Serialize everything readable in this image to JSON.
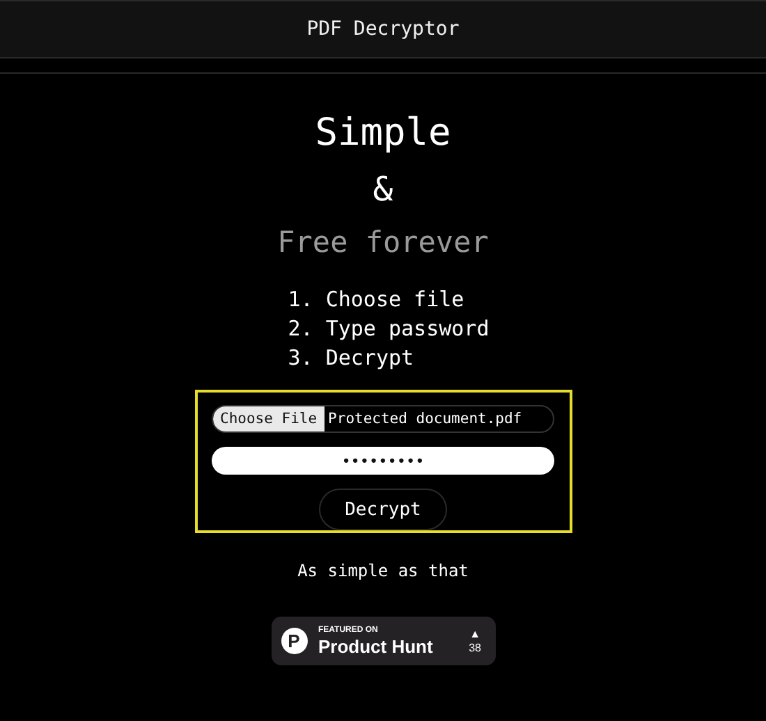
{
  "header": {
    "title": "PDF Decryptor"
  },
  "hero": {
    "line_1": "Simple",
    "line_2": "&",
    "line_3": "Free forever"
  },
  "steps": [
    "1. Choose file",
    "2. Type password",
    "3. Decrypt"
  ],
  "form": {
    "file_button": "Choose File",
    "file_name": "Protected document.pdf",
    "password_value": "•••••••••",
    "submit": "Decrypt"
  },
  "tagline": "As simple as that",
  "badge": {
    "logo": "P",
    "caption": "FEATURED ON",
    "name": "Product Hunt",
    "arrow": "▲",
    "count": "38"
  }
}
